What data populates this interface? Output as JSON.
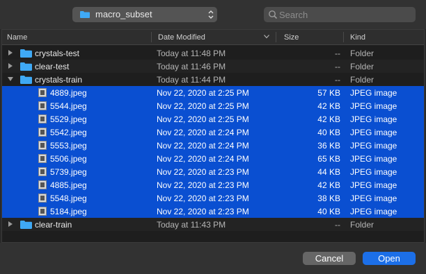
{
  "toolbar": {
    "folder": "macro_subset",
    "search_placeholder": "Search"
  },
  "columns": {
    "name": "Name",
    "date": "Date Modified",
    "size": "Size",
    "kind": "Kind"
  },
  "rows": [
    {
      "name": "crystals-test",
      "date": "Today at 11:48 PM",
      "size": "--",
      "kind": "Folder"
    },
    {
      "name": "clear-test",
      "date": "Today at 11:46 PM",
      "size": "--",
      "kind": "Folder"
    },
    {
      "name": "crystals-train",
      "date": "Today at 11:44 PM",
      "size": "--",
      "kind": "Folder"
    },
    {
      "name": "4889.jpeg",
      "date": "Nov 22, 2020 at 2:25 PM",
      "size": "57 KB",
      "kind": "JPEG image"
    },
    {
      "name": "5544.jpeg",
      "date": "Nov 22, 2020 at 2:25 PM",
      "size": "42 KB",
      "kind": "JPEG image"
    },
    {
      "name": "5529.jpeg",
      "date": "Nov 22, 2020 at 2:25 PM",
      "size": "42 KB",
      "kind": "JPEG image"
    },
    {
      "name": "5542.jpeg",
      "date": "Nov 22, 2020 at 2:24 PM",
      "size": "40 KB",
      "kind": "JPEG image"
    },
    {
      "name": "5553.jpeg",
      "date": "Nov 22, 2020 at 2:24 PM",
      "size": "36 KB",
      "kind": "JPEG image"
    },
    {
      "name": "5506.jpeg",
      "date": "Nov 22, 2020 at 2:24 PM",
      "size": "65 KB",
      "kind": "JPEG image"
    },
    {
      "name": "5739.jpeg",
      "date": "Nov 22, 2020 at 2:23 PM",
      "size": "44 KB",
      "kind": "JPEG image"
    },
    {
      "name": "4885.jpeg",
      "date": "Nov 22, 2020 at 2:23 PM",
      "size": "42 KB",
      "kind": "JPEG image"
    },
    {
      "name": "5548.jpeg",
      "date": "Nov 22, 2020 at 2:23 PM",
      "size": "38 KB",
      "kind": "JPEG image"
    },
    {
      "name": "5184.jpeg",
      "date": "Nov 22, 2020 at 2:23 PM",
      "size": "40 KB",
      "kind": "JPEG image"
    },
    {
      "name": "clear-train",
      "date": "Today at 11:43 PM",
      "size": "--",
      "kind": "Folder"
    }
  ],
  "buttons": {
    "cancel": "Cancel",
    "open": "Open"
  },
  "colors": {
    "selection": "#0a4fd1",
    "folder": "#3fa9f5",
    "primary_button": "#1c6fe8"
  }
}
